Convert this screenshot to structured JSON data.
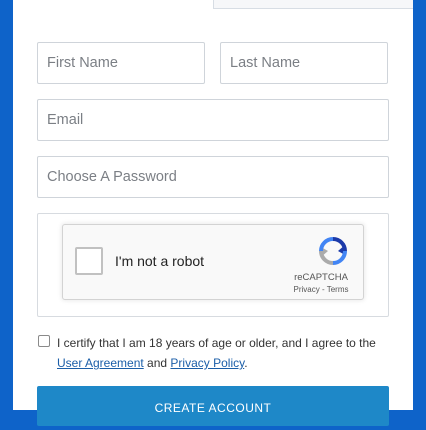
{
  "form": {
    "first_name_placeholder": "First Name",
    "last_name_placeholder": "Last Name",
    "email_placeholder": "Email",
    "password_placeholder": "Choose A Password"
  },
  "recaptcha": {
    "label": "I'm not a robot",
    "brand": "reCAPTCHA",
    "privacy": "Privacy",
    "separator": " - ",
    "terms": "Terms",
    "checked": false
  },
  "certify": {
    "text_before": "I certify that I am 18 years of age or older, and I agree to the ",
    "user_agreement": "User Agreement",
    "and": " and ",
    "privacy_policy": "Privacy Policy",
    "period": ".",
    "checked": false
  },
  "submit": {
    "label": "CREATE ACCOUNT"
  },
  "colors": {
    "page_background": "#0e63c9",
    "button": "#1e88c8",
    "link": "#1b5ea8"
  }
}
